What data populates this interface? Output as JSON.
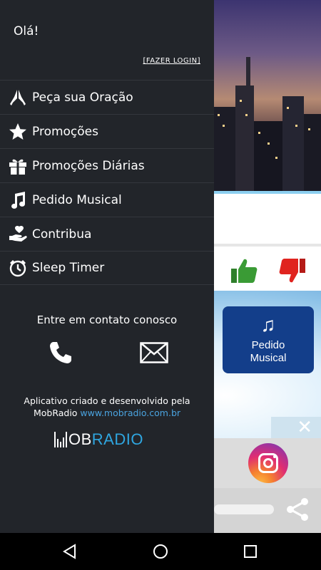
{
  "drawer": {
    "greeting": "Olá!",
    "login_link": "[FAZER LOGIN]",
    "menu": [
      {
        "label": "Peça sua Oração",
        "icon": "praying-hands-icon"
      },
      {
        "label": "Promoções",
        "icon": "star-icon"
      },
      {
        "label": "Promoções Diárias",
        "icon": "gift-icon"
      },
      {
        "label": "Pedido Musical",
        "icon": "music-note-icon"
      },
      {
        "label": "Contribua",
        "icon": "hand-heart-icon"
      },
      {
        "label": "Sleep Timer",
        "icon": "alarm-clock-icon"
      }
    ],
    "contact": {
      "title": "Entre em contato conosco",
      "phone_icon": "phone-icon",
      "email_icon": "email-icon"
    },
    "credits": {
      "line1": "Aplicativo criado e desenvolvido pela",
      "line2_prefix": "MobRadio ",
      "link": "www.mobradio.com.br"
    },
    "logo": {
      "mob": "OB",
      "radio": "RADIO"
    }
  },
  "background": {
    "pedido_button": {
      "line1": "Pedido",
      "line2": "Musical"
    },
    "colors": {
      "drawer": "#22252a",
      "pedido": "#133e8a",
      "link": "#4aa3df",
      "thumb_up": "#3a9b35",
      "thumb_down": "#e0241f"
    }
  },
  "navbar": {
    "back": "back-icon",
    "home": "home-icon",
    "recent": "recent-apps-icon"
  }
}
